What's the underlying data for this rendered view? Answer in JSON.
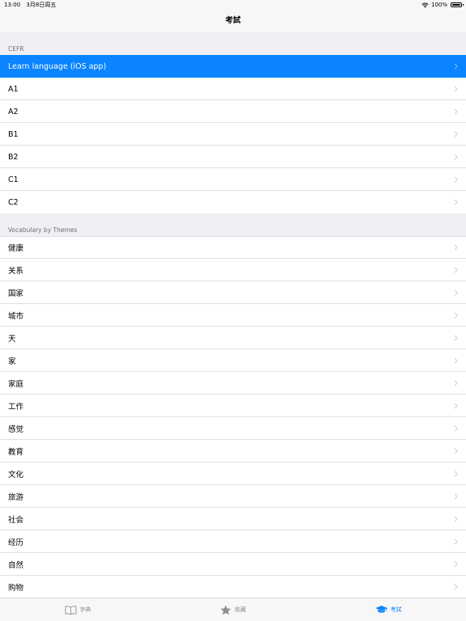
{
  "status_bar": {
    "time": "13:00",
    "date": "3月8日周五",
    "battery": "100%"
  },
  "nav": {
    "title": "考試"
  },
  "sections": [
    {
      "header": "CEFR",
      "items": [
        {
          "label": "Learn language (iOS app)",
          "selected": true
        },
        {
          "label": "A1"
        },
        {
          "label": "A2"
        },
        {
          "label": "B1"
        },
        {
          "label": "B2"
        },
        {
          "label": "C1"
        },
        {
          "label": "C2"
        }
      ]
    },
    {
      "header": "Vocabulary by Themes",
      "items": [
        {
          "label": "健康"
        },
        {
          "label": "关系"
        },
        {
          "label": "国家"
        },
        {
          "label": "城市"
        },
        {
          "label": "天"
        },
        {
          "label": "家"
        },
        {
          "label": "家庭"
        },
        {
          "label": "工作"
        },
        {
          "label": "感觉"
        },
        {
          "label": "教育"
        },
        {
          "label": "文化"
        },
        {
          "label": "旅游"
        },
        {
          "label": "社会"
        },
        {
          "label": "经历"
        },
        {
          "label": "自然"
        },
        {
          "label": "购物"
        }
      ]
    }
  ],
  "tab_bar": {
    "tabs": [
      {
        "label": "字典",
        "icon": "book-icon"
      },
      {
        "label": "收藏",
        "icon": "star-icon"
      },
      {
        "label": "考試",
        "icon": "graduation-cap-icon",
        "active": true
      }
    ]
  },
  "colors": {
    "accent": "#0a84ff",
    "background": "#efeff4",
    "separator": "#e0e0e4"
  }
}
